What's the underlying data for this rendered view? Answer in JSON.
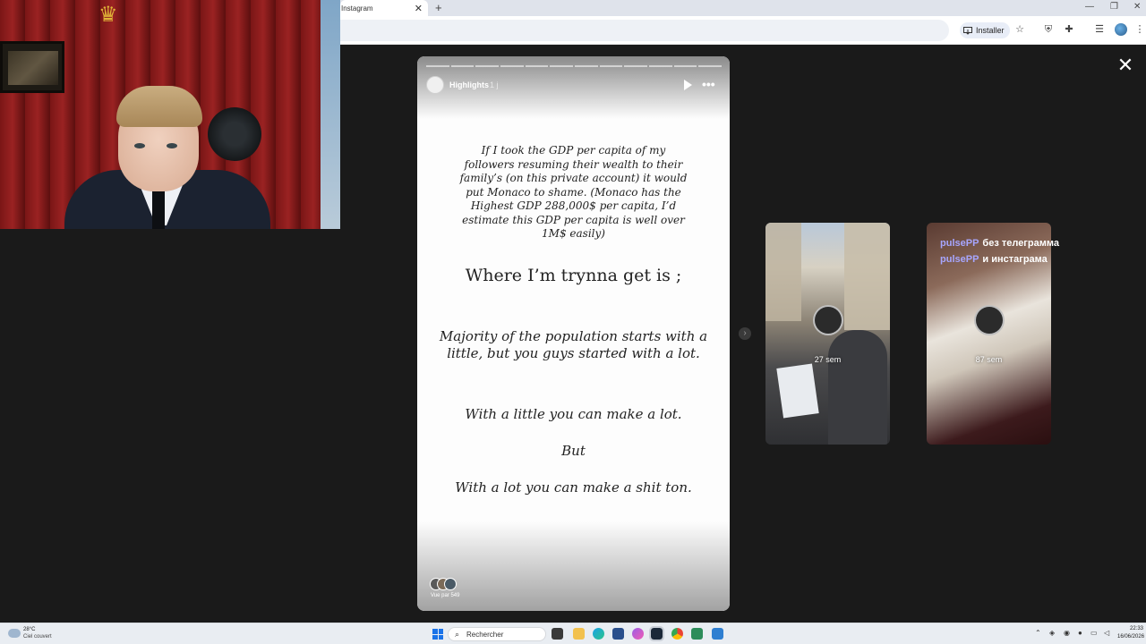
{
  "browser": {
    "tab_title": "Instagram",
    "tab_close": "✕",
    "new_tab": "+",
    "install_label": "Installer",
    "minimize": "—",
    "restore": "❐",
    "close": "✕"
  },
  "viewer": {
    "close": "✕",
    "next": "›"
  },
  "story": {
    "account_name": "Highlights",
    "age": "1 j",
    "more": "•••",
    "paragraph1": "If I took the GDP per capita of my followers resuming their wealth to their family’s (on this private account) it would put Monaco to shame. (Monaco has the Highest GDP 288,000$ per capita, I’d estimate this GDP per capita is well over 1M$ easily)",
    "paragraph2": "Where I’m trynna get is ;",
    "paragraph3": "Majority of the population starts with a little, but you guys started with a lot.",
    "paragraph4": "With a little you can make a lot.",
    "paragraph5": "But",
    "paragraph6": "With a lot you can make a shit ton.",
    "seen_by": "Vue par 549",
    "progress_segments": 12,
    "progress_done": 0
  },
  "previews": [
    {
      "time_label": "27 sem"
    },
    {
      "time_label": "87 sem"
    }
  ],
  "overlay_comments": [
    {
      "user": "pulsePP",
      "text": "без телеграмма"
    },
    {
      "user": "pulsePP",
      "text": "и инстаграма"
    }
  ],
  "taskbar": {
    "weather_temp": "28°C",
    "weather_desc": "Ciel couvert",
    "search_placeholder": "Rechercher",
    "search_icon": "search-icon",
    "time": "22:33",
    "date": "16/06/2026"
  },
  "colors": {
    "page_bg": "#1a1a1a",
    "comment_user": "#a7a6ff",
    "accent_blue": "#1a73e8"
  }
}
